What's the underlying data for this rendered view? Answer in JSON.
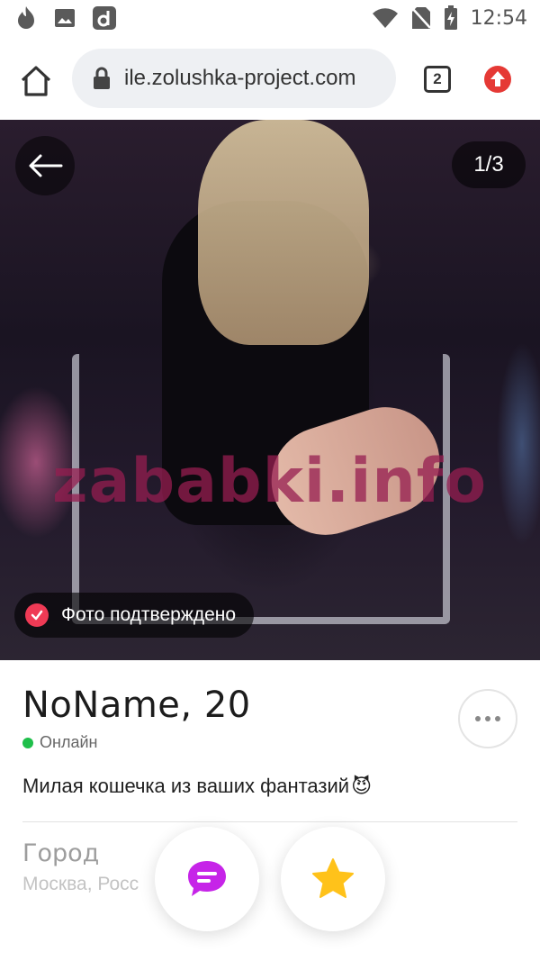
{
  "status_bar": {
    "time": "12:54",
    "left_icons": [
      "fire-icon",
      "image-icon",
      "app-d-icon"
    ],
    "right_icons": [
      "wifi-icon",
      "no-sim-icon",
      "battery-charging-icon"
    ]
  },
  "browser": {
    "url": "ile.zolushka-project.com",
    "tab_count": "2",
    "accent_color": "#e53935"
  },
  "photo": {
    "counter": "1/3",
    "watermark": "zababki.info",
    "verified_label": "Фото подтверждено"
  },
  "profile": {
    "name_age": "NoName, 20",
    "status": "Онлайн",
    "status_color": "#1fbf4a",
    "bio": "Милая кошечка из ваших фантазий",
    "bio_emoji": "😈",
    "city_label": "Город",
    "city_value": "Москва, Росс"
  },
  "actions": {
    "chat_color": "#c624e8",
    "favorite_color": "#ffc21a"
  }
}
